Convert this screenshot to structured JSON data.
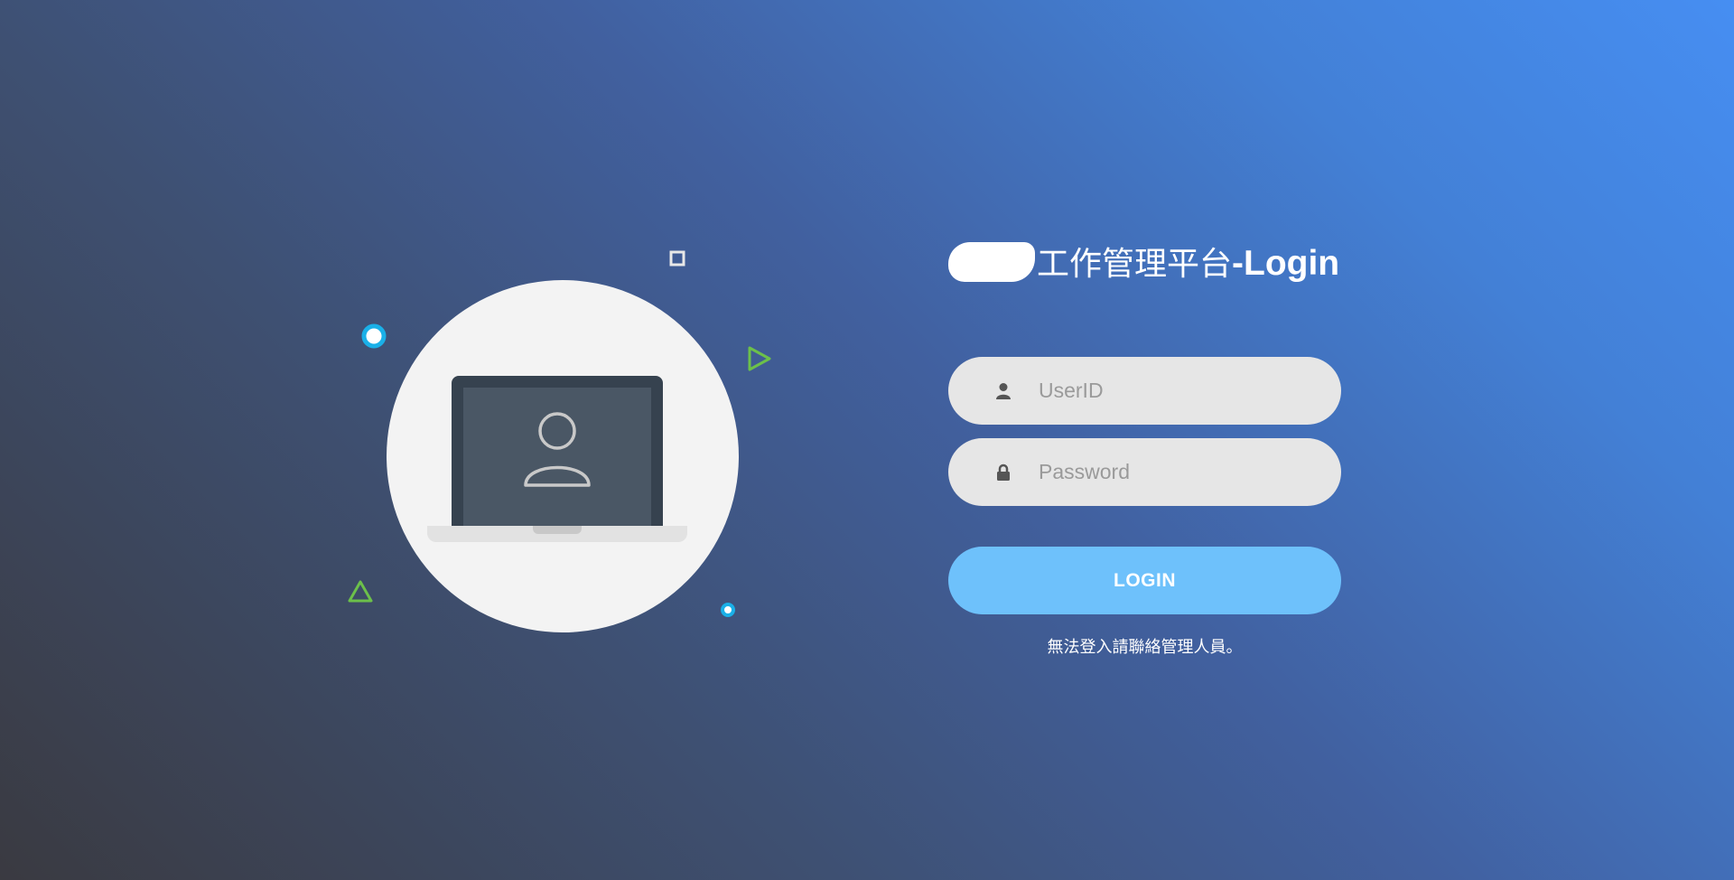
{
  "header": {
    "title": "工作管理平台",
    "title_suffix": "-Login"
  },
  "login_form": {
    "userid_placeholder": "UserID",
    "password_placeholder": "Password",
    "userid_icon": "user-icon",
    "password_icon": "lock-icon",
    "login_label": "LOGIN",
    "help_text": "無法登入請聯絡管理人員。"
  },
  "illustration": {
    "icon": "laptop-user-icon"
  },
  "colors": {
    "login_button": "#6ec1fb",
    "input_background": "#e6e6e6",
    "deco_cyan": "#1ab0e8",
    "deco_green": "#6cc04a"
  }
}
